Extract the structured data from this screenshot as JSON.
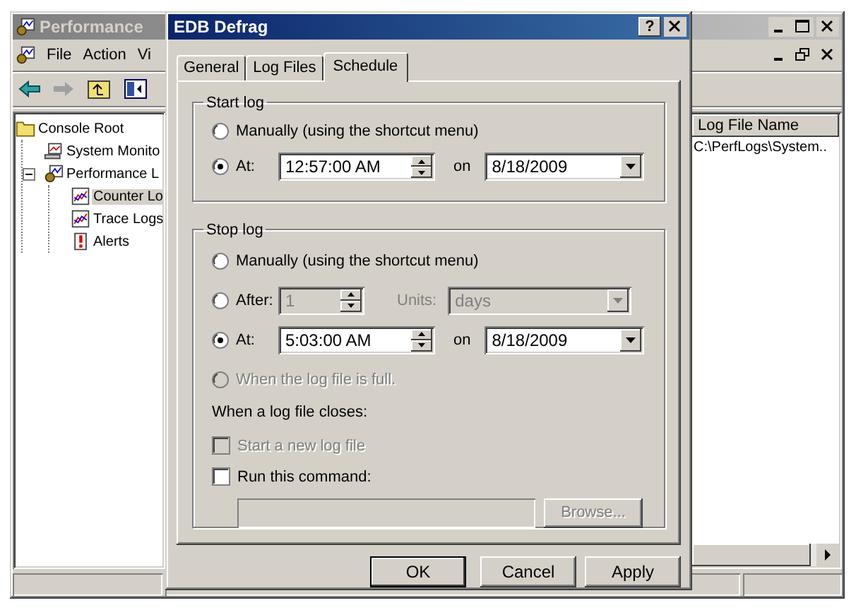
{
  "main_window": {
    "title": "Performance",
    "menu": [
      "File",
      "Action",
      "Vi"
    ],
    "tree": [
      {
        "label": "Console Root",
        "kind": "folder",
        "selected": false,
        "children": [
          {
            "label": "System Monito",
            "kind": "monitor",
            "selected": false
          },
          {
            "label": "Performance L",
            "kind": "perf",
            "selected": false,
            "expanded": true,
            "children": [
              {
                "label": "Counter Lo",
                "kind": "chart",
                "selected": true
              },
              {
                "label": "Trace Logs",
                "kind": "chart",
                "selected": false
              },
              {
                "label": "Alerts",
                "kind": "alert",
                "selected": false
              }
            ]
          }
        ]
      }
    ],
    "list": {
      "columns": [
        "Log File Name"
      ],
      "rows": [
        [
          "C:\\PerfLogs\\System.."
        ]
      ]
    }
  },
  "dialog": {
    "title": "EDB Defrag",
    "help": "?",
    "tabs": [
      {
        "label": "General",
        "selected": false
      },
      {
        "label": "Log Files",
        "selected": false
      },
      {
        "label": "Schedule",
        "selected": true
      }
    ],
    "start_log": {
      "title": "Start log",
      "options": [
        {
          "kind": "plain",
          "label": "Manually (using the shortcut menu)",
          "selected": false,
          "disabled": false
        },
        {
          "kind": "at",
          "label": "At:",
          "selected": true,
          "disabled": false,
          "time": "12:57:00 AM",
          "on": "on",
          "date": "8/18/2009"
        }
      ]
    },
    "stop_log": {
      "title": "Stop log",
      "options": [
        {
          "kind": "plain",
          "label": "Manually (using the shortcut menu)",
          "selected": false,
          "disabled": false
        },
        {
          "kind": "after",
          "label": "After:",
          "selected": false,
          "disabled": false,
          "value": "1",
          "units_label": "Units:",
          "units": "days"
        },
        {
          "kind": "at",
          "label": "At:",
          "selected": true,
          "disabled": false,
          "time": "5:03:00 AM",
          "on": "on",
          "date": "8/18/2009"
        },
        {
          "kind": "plain",
          "label": "When the log file is full.",
          "selected": false,
          "disabled": true
        }
      ],
      "closes_label": "When a log file closes:",
      "checks": [
        {
          "label": "Start a new log file",
          "checked": false,
          "disabled": true
        },
        {
          "label": "Run this command:",
          "checked": false,
          "disabled": false
        }
      ],
      "browse": {
        "label": "Browse...",
        "disabled": true
      }
    },
    "buttons": [
      "OK",
      "Cancel",
      "Apply"
    ]
  }
}
